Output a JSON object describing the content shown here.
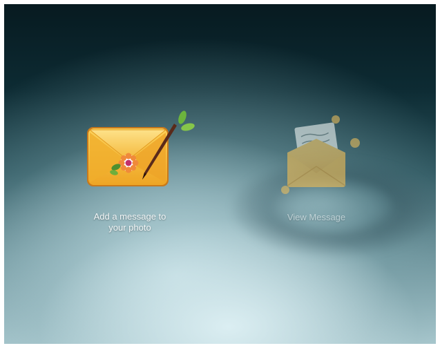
{
  "menu": {
    "items": [
      {
        "label": "Add a message to\nyour photo",
        "icon": "envelope-pen-icon"
      },
      {
        "label": "View Message",
        "icon": "open-envelope-letter-icon"
      }
    ]
  },
  "colors": {
    "envelope_yellow": "#f6bd3a",
    "envelope_dark": "#e19a1c",
    "background_dark": "#071a20",
    "background_light": "#dbeef2",
    "label_text": "#f2f6f7"
  }
}
